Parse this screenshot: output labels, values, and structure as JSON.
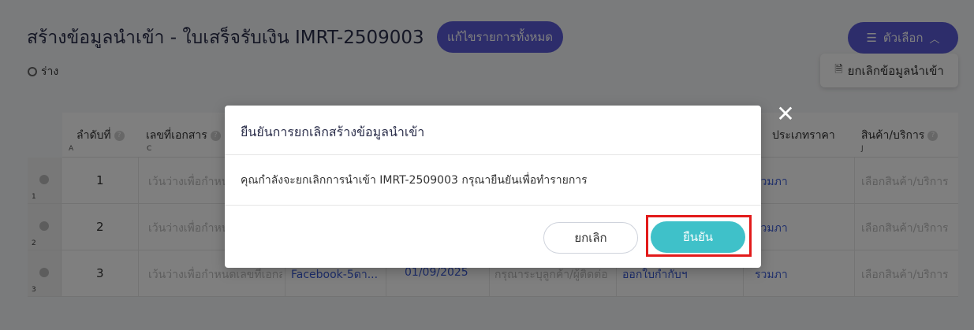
{
  "header": {
    "title": "สร้างข้อมูลนำเข้า - ใบเสร็จรับเงิน IMRT-2509003",
    "edit_all_label": "แก้ไขรายการทั้งหมด",
    "status": "ร่าง",
    "options_label": "ตัวเลือก",
    "cancel_import_label": "ยกเลิกข้อมูลนำเข้า"
  },
  "table": {
    "columns": [
      {
        "label": "ลำดับที่",
        "letter": "A"
      },
      {
        "label": "เลขที่เอกสาร",
        "letter": "C"
      },
      {
        "label": "ประเภทราคา",
        "letter": ""
      },
      {
        "label": "สินค้า/บริการ",
        "letter": "J"
      }
    ],
    "rows": [
      {
        "index": "1",
        "seq": "1",
        "doc_placeholder": "เว้นว่างเพื่อกำหนดเลขที่เอกสาร",
        "price_type": "รวมภาษี",
        "product_placeholder": "เลือกสินค้า/บริการ"
      },
      {
        "index": "2",
        "seq": "2",
        "doc_placeholder": "เว้นว่างเพื่อกำหนดเลขที่เอกสาร",
        "price_type": "รวมภาษี",
        "product_placeholder": "เลือกสินค้า/บริการ"
      },
      {
        "index": "3",
        "seq": "3",
        "doc_placeholder": "เว้นว่างเพื่อกำหนดเลขที่เอกสาร",
        "channel": "Facebook-5ดา...",
        "date": "01/09/2025",
        "customer": "กรุณาระบุลูกค้า/ผู้ติดต่อ",
        "tax_type": "ออกใบกำกับฯ",
        "price_type": "รวมภาษี",
        "product_placeholder": "เลือกสินค้า/บริการ"
      }
    ]
  },
  "modal": {
    "title": "ยืนยันการยกเลิกสร้างข้อมูลนำเข้า",
    "body": "คุณกำลังจะยกเลิกการนำเข้า IMRT-2509003 กรุณายืนยันเพื่อทำรายการ",
    "cancel_label": "ยกเลิก",
    "confirm_label": "ยืนยัน",
    "close_symbol": "✕"
  },
  "colors": {
    "accent": "#5b5bd6",
    "confirm": "#3fc1c9",
    "highlight": "#e21b1b"
  }
}
